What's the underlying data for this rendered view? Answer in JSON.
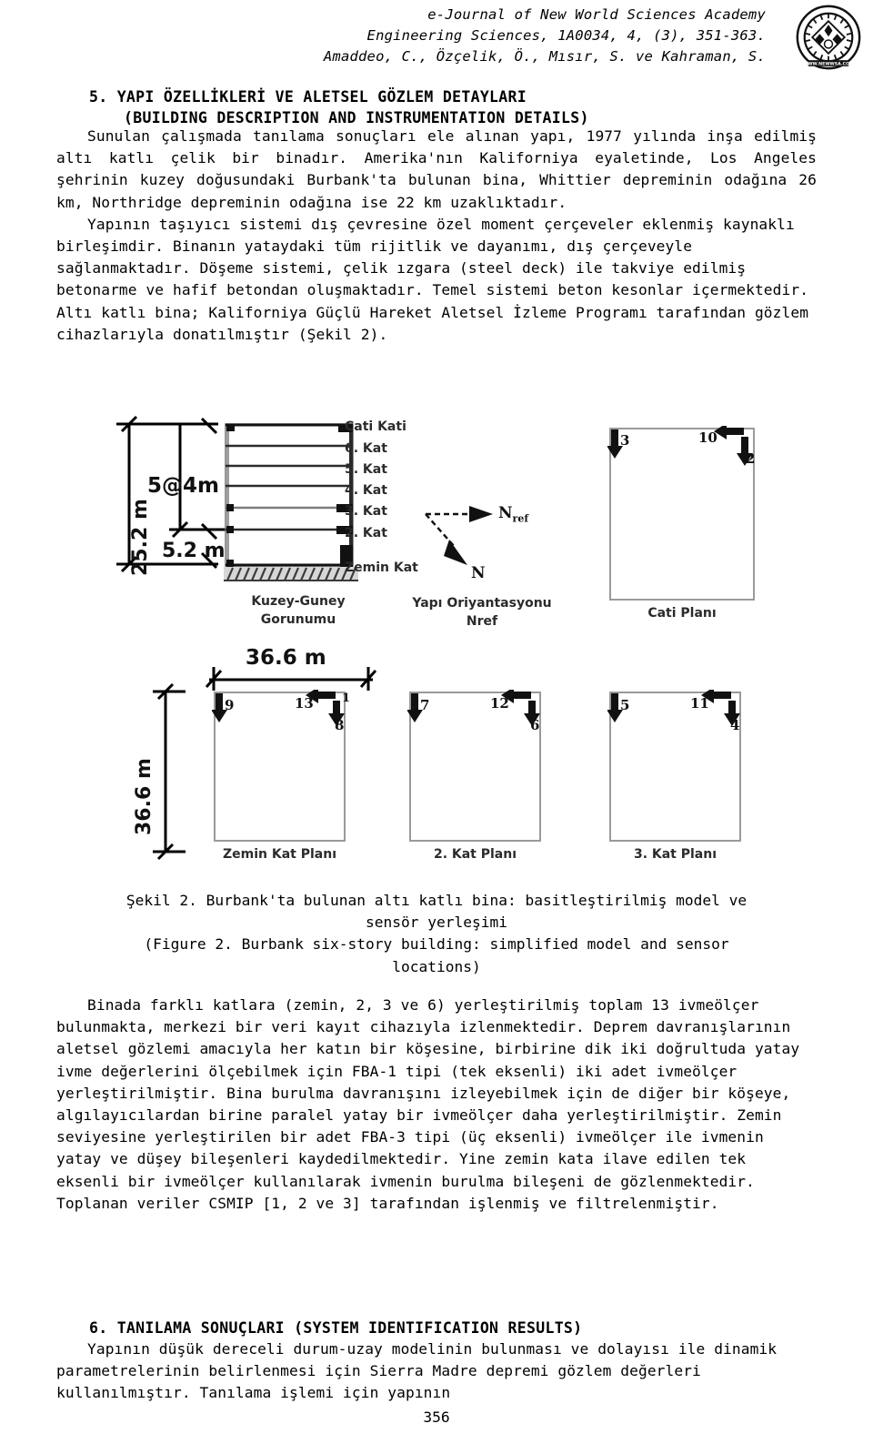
{
  "header": {
    "line1": "e-Journal of New World Sciences Academy",
    "line2": "Engineering Sciences, 1A0034, 4, (3), 351-363.",
    "line3": "Amaddeo, C., Özçelik, Ö., Mısır, S. ve Kahraman, S.",
    "logo_alt": "journal-seal",
    "logo_text_outer": "NEW WORLD SCIENCES ACADEMY",
    "logo_text_url": "WWW.NEWWSA.COM"
  },
  "section5": {
    "number_title": "5. YAPI ÖZELLİKLERİ VE ALETSEL GÖZLEM DETAYLARI",
    "english_title": "(BUILDING DESCRIPTION AND INSTRUMENTATION DETAILS)"
  },
  "section6": {
    "title": "6. TANILAMA SONUÇLARI (SYSTEM IDENTIFICATION RESULTS)"
  },
  "paragraph1": {
    "text": "Sunulan çalışmada tanılama sonuçları ele alınan yapı, 1977 yılında inşa edilmiş altı katlı çelik bir binadır. Amerika'nın Kaliforniya eyaletinde, Los Angeles şehrinin kuzey doğusundaki Burbank'ta bulunan bina, Whittier depreminin odağına 26 km, Northridge depreminin odağına ise 22 km uzaklıktadır."
  },
  "paragraph2": {
    "text": "Yapının taşıyıcı sistemi dış çevresine özel moment çerçeveler eklenmiş kaynaklı birleşimdir. Binanın yataydaki tüm rijitlik ve dayanımı, dış çerçeveyle sağlanmaktadır. Döşeme sistemi, çelik ızgara (steel deck) ile takviye edilmiş betonarme ve hafif betondan oluşmaktadır. Temel sistemi beton kesonlar içermektedir. Altı katlı bina; Kaliforniya Güçlü Hareket Aletsel İzleme Programı tarafından gözlem cihazlarıyla donatılmıştır (Şekil 2)."
  },
  "paragraph3": {
    "text": "Binada farklı katlara (zemin, 2, 3 ve 6) yerleştirilmiş toplam 13 ivmeölçer bulunmakta, merkezi bir veri kayıt cihazıyla izlenmektedir. Deprem davranışlarının aletsel gözlemi amacıyla her katın bir köşesine, birbirine dik iki doğrultuda yatay ivme değerlerini ölçebilmek için FBA-1 tipi (tek eksenli) iki adet ivmeölçer yerleştirilmiştir. Bina burulma davranışını izleyebilmek için de diğer bir köşeye, algılayıcılardan birine paralel yatay bir ivmeölçer daha yerleştirilmiştir. Zemin seviyesine yerleştirilen bir adet FBA-3 tipi (üç eksenli) ivmeölçer ile ivmenin yatay ve düşey bileşenleri kaydedilmektedir. Yine zemin kata ilave edilen tek eksenli bir ivmeölçer kullanılarak ivmenin burulma bileşeni de gözlenmektedir. Toplanan veriler CSMIP [1, 2 ve 3] tarafından işlenmiş ve filtrelenmiştir."
  },
  "paragraph4": {
    "text": "Yapının düşük dereceli durum-uzay modelinin bulunması ve dolayısı ile dinamik parametrelerinin belirlenmesi için Sierra Madre depremi gözlem değerleri kullanılmıştır. Tanılama işlemi için yapının"
  },
  "caption": {
    "tr_line1": "Şekil 2. Burbank'ta bulunan altı katlı bina: basitleştirilmiş model ve",
    "tr_line2": "sensör yerleşimi",
    "en_line1": "(Figure 2. Burbank six-story building: simplified model and sensor",
    "en_line2": "locations)"
  },
  "figure": {
    "elevation": {
      "total_height_label": "25.2 m",
      "typical_story_label": "5@4m",
      "ground_story_label": "5.2 m",
      "caption_line1": "Kuzey-Guney",
      "caption_line2": "Gorunumu",
      "floor_labels": [
        "Cati Kati",
        "6. Kat",
        "5. Kat",
        "4. Kat",
        "3. Kat",
        "2. Kat",
        "Zemin Kat"
      ]
    },
    "orientation": {
      "nref_label": "Nref",
      "n_label": "N",
      "caption_line1": "Yapı Oriyantasyonu",
      "caption_line2": "Nref"
    },
    "plans": [
      {
        "name": "roof-plan",
        "caption": "Cati Planı",
        "sensors": [
          {
            "id": "3",
            "dir": "down",
            "corner": "top-left"
          },
          {
            "id": "10",
            "dir": "left",
            "corner": "top-right"
          },
          {
            "id": "2",
            "dir": "down",
            "corner": "top-right"
          }
        ]
      },
      {
        "name": "ground-floor-plan",
        "caption": "Zemin Kat Planı",
        "width_label": "36.6 m",
        "depth_label": "36.6 m",
        "sensors": [
          {
            "id": "9",
            "dir": "down",
            "corner": "top-left"
          },
          {
            "id": "13",
            "dir": "left",
            "corner": "top-right"
          },
          {
            "id": "1",
            "dir": "label",
            "corner": "top-right"
          },
          {
            "id": "8",
            "dir": "down",
            "corner": "top-right"
          }
        ]
      },
      {
        "name": "second-floor-plan",
        "caption": "2. Kat Planı",
        "sensors": [
          {
            "id": "7",
            "dir": "down",
            "corner": "top-left"
          },
          {
            "id": "12",
            "dir": "left",
            "corner": "top-right"
          },
          {
            "id": "6",
            "dir": "down",
            "corner": "top-right"
          }
        ]
      },
      {
        "name": "third-floor-plan",
        "caption": "3. Kat Planı",
        "sensors": [
          {
            "id": "5",
            "dir": "down",
            "corner": "top-left"
          },
          {
            "id": "11",
            "dir": "left",
            "corner": "top-right"
          },
          {
            "id": "4",
            "dir": "down",
            "corner": "top-right"
          }
        ]
      }
    ]
  },
  "footer": {
    "page_number": "356"
  }
}
